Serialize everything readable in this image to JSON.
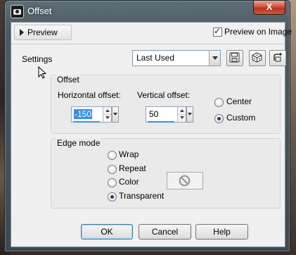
{
  "window": {
    "title": "Offset",
    "close_glyph": "X"
  },
  "preview": {
    "label": "Preview",
    "preview_on_image_label": "Preview on Image",
    "preview_on_image_checked": true
  },
  "settings": {
    "label": "Settings",
    "value": "Last Used"
  },
  "offset": {
    "group_label": "Offset",
    "horizontal_label": "Horizontal offset:",
    "horizontal_value": "-150",
    "vertical_label": "Vertical offset:",
    "vertical_value": "50",
    "mode_options": [
      "Center",
      "Custom"
    ],
    "selected_mode": "Custom"
  },
  "edge_mode": {
    "group_label": "Edge mode",
    "options": [
      "Wrap",
      "Repeat",
      "Color",
      "Transparent"
    ],
    "selected": "Transparent"
  },
  "buttons": {
    "ok": "OK",
    "cancel": "Cancel",
    "help": "Help"
  },
  "icons": [
    "camera-icon",
    "save-preset-icon",
    "dice-icon",
    "reset-icon",
    "no-color-icon",
    "mouse-cursor-icon"
  ]
}
